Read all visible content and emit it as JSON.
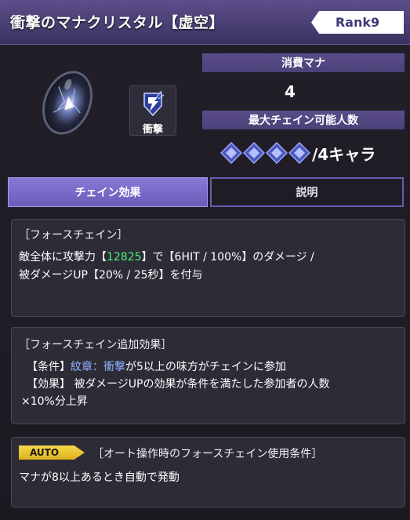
{
  "header": {
    "title": "衝撃のマナクリスタル【虚空】",
    "rank": "Rank9"
  },
  "attribute": {
    "icon": "impact-icon",
    "label": "衝撃"
  },
  "mana": {
    "label": "消費マナ",
    "value": "4"
  },
  "chain": {
    "label": "最大チェイン可能人数",
    "count_text": "/4キャラ",
    "icons": 4
  },
  "tabs": {
    "active": "チェイン効果",
    "inactive": "説明"
  },
  "force_chain": {
    "title": "［フォースチェイン］",
    "line1_prefix": "敵全体に攻撃力【",
    "attack_value": "12825",
    "line1_suffix": "】で【6HIT / 100%】のダメージ /",
    "line2": "被ダメージUP【20% / 25秒】を付与"
  },
  "force_chain_extra": {
    "title": "［フォースチェイン追加効果］",
    "cond_prefix": "【条件】",
    "cond_highlight": "紋章：衝撃",
    "cond_suffix": "が5以上の味方がチェインに参加",
    "effect_line1": "【効果】 被ダメージUPの効果が条件を満たした参加者の人数",
    "effect_line2": "×10%分上昇"
  },
  "auto": {
    "badge": "AUTO",
    "title": "［オート操作時のフォースチェイン使用条件］",
    "line": "マナが8以上あるとき自動で発動"
  },
  "colors": {
    "accent": "#6b5bb8",
    "highlight_green": "#4cf27a",
    "highlight_blue": "#8fb2ff",
    "auto_yellow": "#f5d74b"
  }
}
